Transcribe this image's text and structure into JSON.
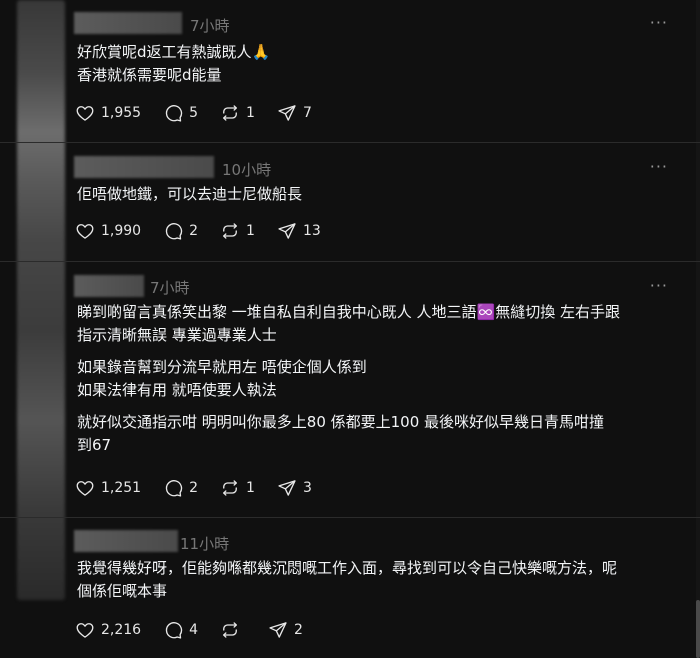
{
  "posts": [
    {
      "time": "7小時",
      "lines": [
        "好欣賞呢d返工有熱誠既人🙏",
        "香港就係需要呢d能量"
      ],
      "likes": "1,955",
      "comments": "5",
      "reposts": "1",
      "shares": "7"
    },
    {
      "time": "10小時",
      "lines": [
        "佢唔做地鐵，可以去迪士尼做船長"
      ],
      "likes": "1,990",
      "comments": "2",
      "reposts": "1",
      "shares": "13"
    },
    {
      "time": "7小時",
      "paragraphs": [
        [
          "睇到啲留言真係笑出黎 一堆自私自利自我中心既人 人地三語♾️無縫切換 左右手跟",
          "指示清晰無誤 專業過專業人士"
        ],
        [
          "如果錄音幫到分流早就用左 唔使企個人係到",
          "如果法律有用 就唔使要人執法"
        ],
        [
          "就好似交通指示咁 明明叫你最多上80 係都要上100 最後咪好似早幾日青馬咁撞",
          "到67"
        ]
      ],
      "likes": "1,251",
      "comments": "2",
      "reposts": "1",
      "shares": "3"
    },
    {
      "time": "11小時",
      "lines": [
        "我覺得幾好呀，佢能夠喺都幾沉悶嘅工作入面，尋找到可以令自己快樂嘅方法，呢",
        "個係佢嘅本事"
      ],
      "likes": "2,216",
      "comments": "4",
      "reposts": "",
      "shares": "2"
    }
  ],
  "icons": {
    "like": "heart-icon",
    "comment": "comment-bubble-icon",
    "repost": "repost-icon",
    "share": "send-icon",
    "more": "more-dots-icon"
  },
  "ui": {
    "more_glyph": "···"
  }
}
